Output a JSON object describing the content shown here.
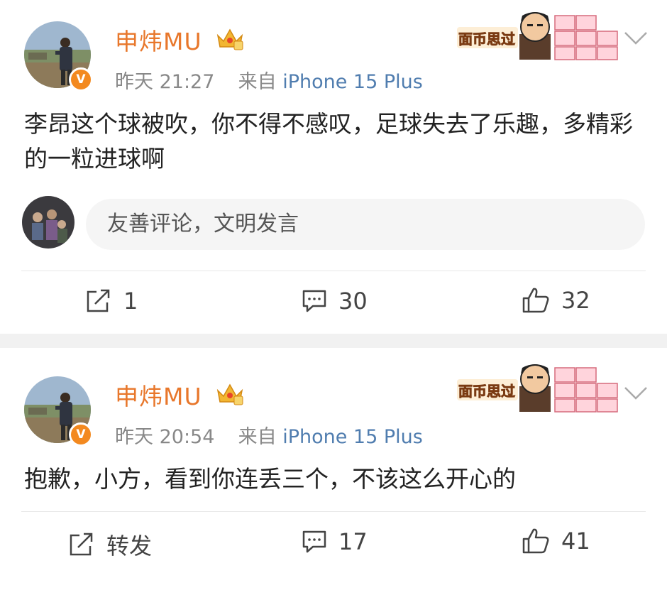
{
  "posts": [
    {
      "username": "申炜MU",
      "time": "昨天 21:27",
      "from_label": "来自",
      "source": "iPhone 15 Plus",
      "content": "李昂这个球被吹，你不得不感叹，足球失去了乐趣，多精彩的一粒进球啊",
      "comment_placeholder": "友善评论，文明发言",
      "deco_text": "面币思过",
      "actions": {
        "repost": "1",
        "comments": "30",
        "likes": "32"
      }
    },
    {
      "username": "申炜MU",
      "time": "昨天 20:54",
      "from_label": "来自",
      "source": "iPhone 15 Plus",
      "content": "抱歉，小方，看到你连丢三个，不该这么开心的",
      "deco_text": "面币思过",
      "actions": {
        "repost": "转发",
        "comments": "17",
        "likes": "41"
      }
    }
  ],
  "icons": {
    "verified": "verified-v-icon",
    "crown": "vip-crown-icon",
    "repost": "share-icon",
    "comment": "comment-icon",
    "like": "thumbs-up-icon",
    "menu": "chevron-down-icon"
  },
  "colors": {
    "username": "#e8772b",
    "source": "#507daf",
    "verified": "#f3891f"
  }
}
